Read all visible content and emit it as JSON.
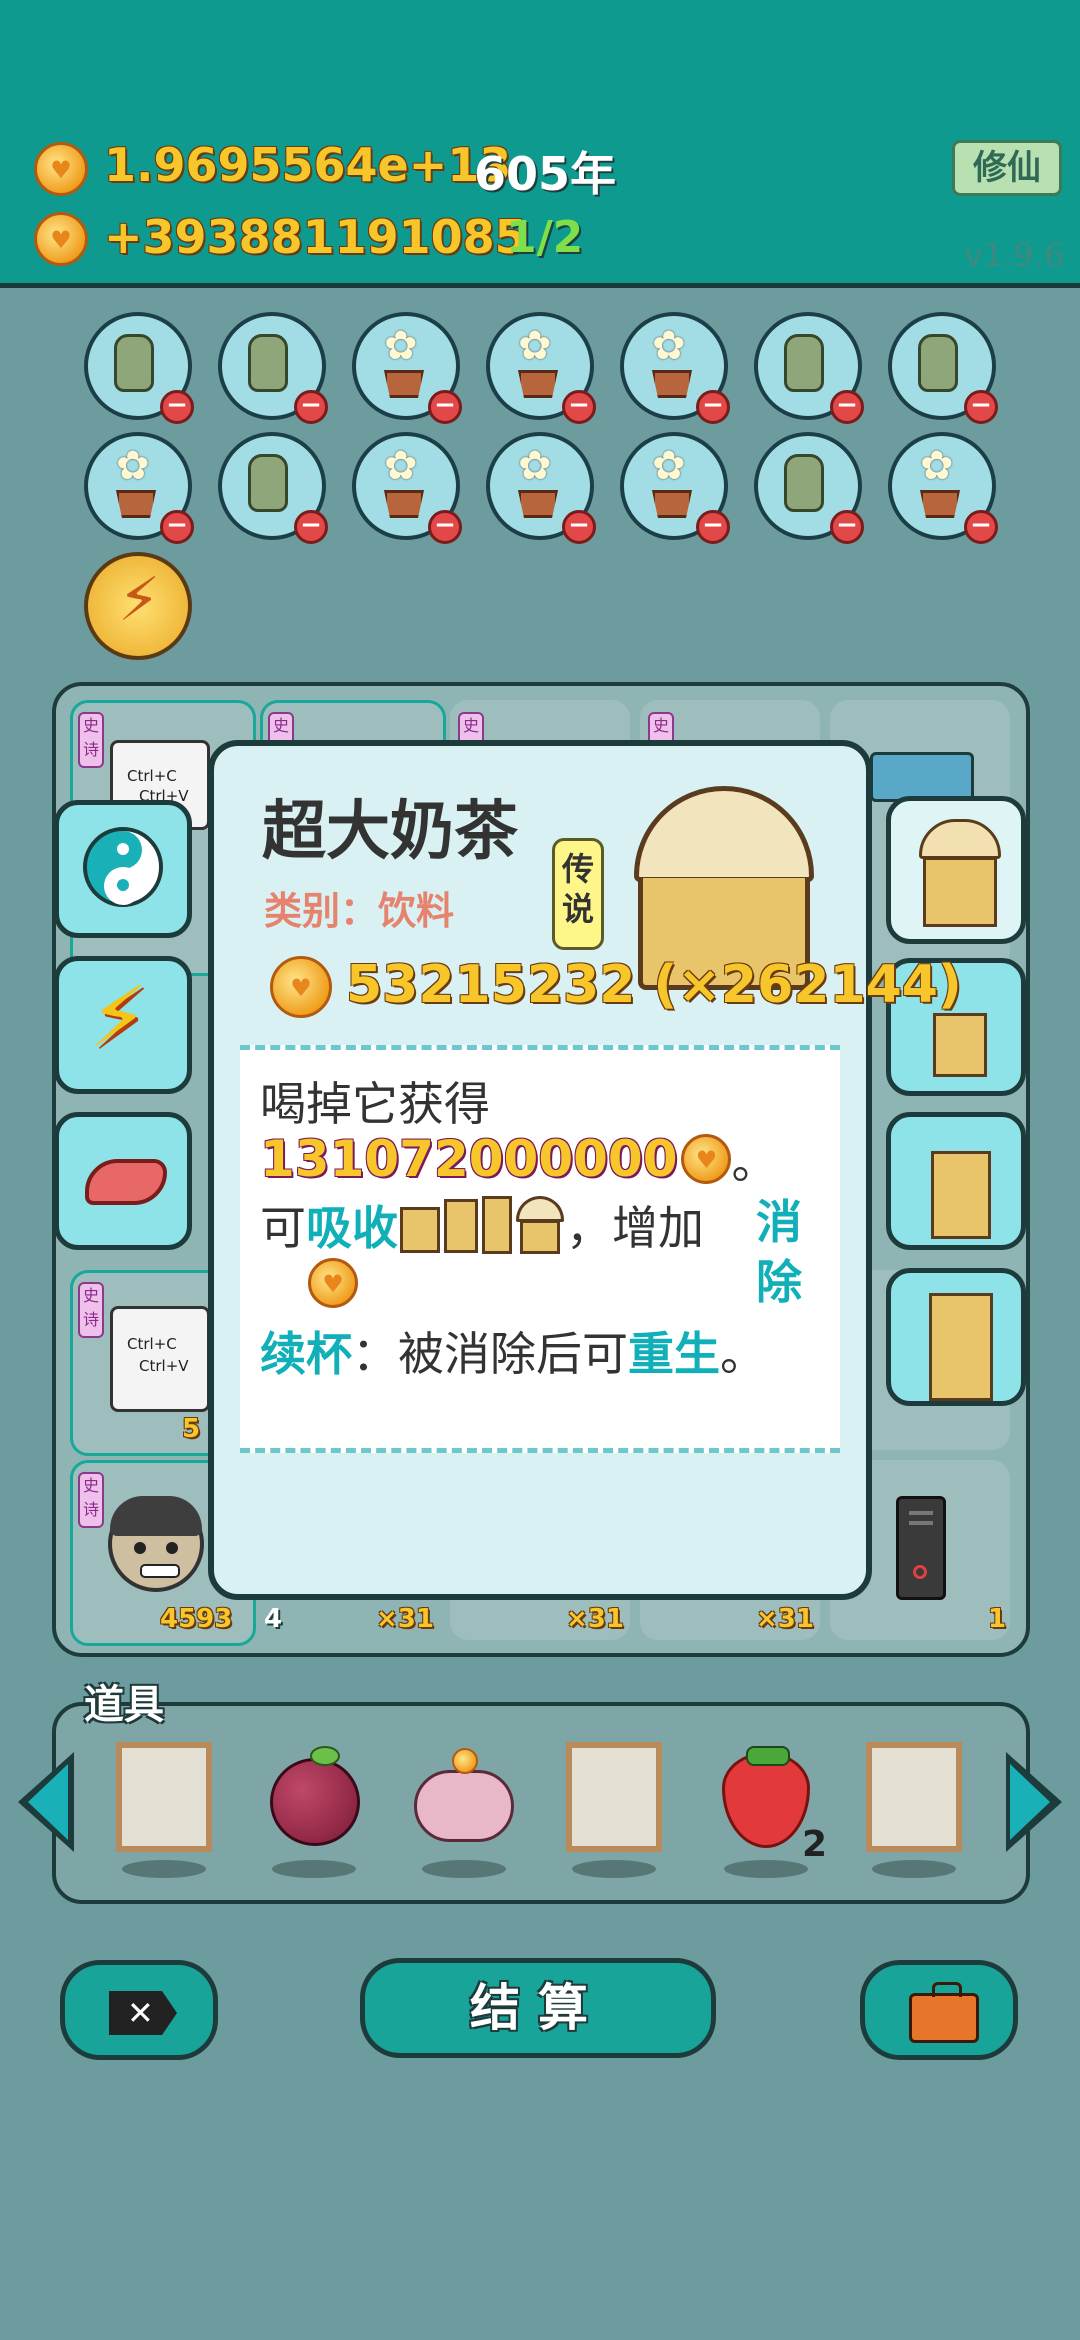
{
  "header": {
    "total_coins": "1.9695564e+13",
    "year": "605年",
    "income": "+393881191085",
    "progress": "1/2",
    "cultivate_label": "修仙",
    "version": "v1.9.6"
  },
  "board_counts": {
    "c1": "5",
    "c2": "4593",
    "c3": "4",
    "c4": "×31",
    "c5": "×31",
    "c6": "×31",
    "c7": "1"
  },
  "card_text": {
    "ctrl_c": "Ctrl+C",
    "ctrl_v": "Ctrl+V",
    "tag": "史诗"
  },
  "popup": {
    "title": "超大奶茶",
    "category": "类别：饮料",
    "rarity": "传说",
    "price": "53215232 (×262144)",
    "desc_line1": "喝掉它获得",
    "desc_reward": "131072000000",
    "period": "。",
    "desc_absorb_pre": "可",
    "desc_absorb": "吸收",
    "desc_absorb_post": "，增加",
    "desc_eliminate": "消除",
    "desc_refill": "续杯",
    "desc_refill_mid": "：被消除后可",
    "desc_reborn": "重生"
  },
  "items": {
    "label": "道具",
    "strawberry_count": "2"
  },
  "buttons": {
    "settle": "结算"
  },
  "colors": {
    "header_bg": "#0e9a8e",
    "coin_gold": "#f7c62a",
    "accent_cyan": "#11b0b8",
    "minus_red": "#e24848"
  }
}
